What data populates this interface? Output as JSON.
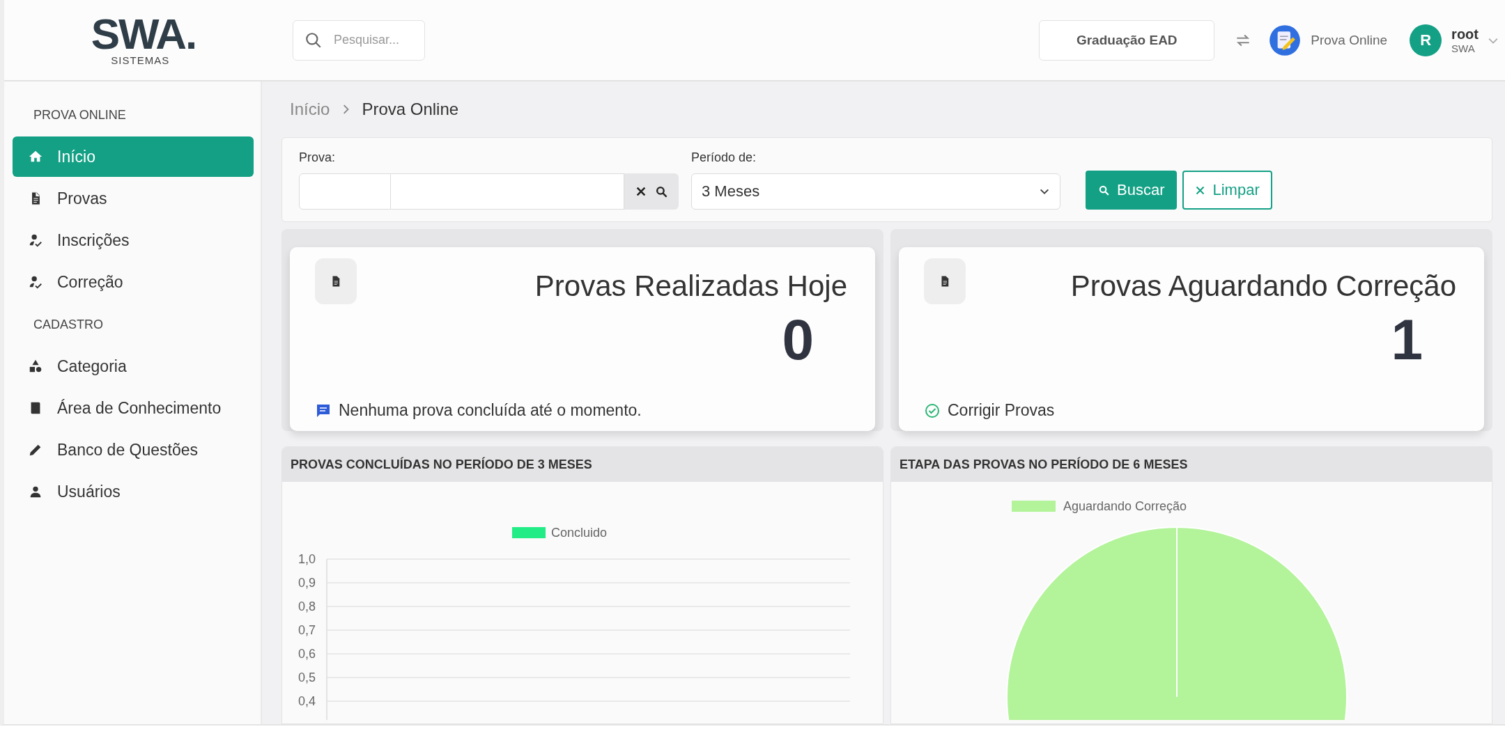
{
  "header": {
    "logo": {
      "wordmark": "SWA.",
      "subtitle": "SISTEMAS"
    },
    "search": {
      "placeholder": "Pesquisar..."
    },
    "context_button": "Graduação EAD",
    "module": {
      "label": "Prova Online"
    },
    "user": {
      "initial": "R",
      "name": "root",
      "org": "SWA"
    }
  },
  "sidebar": {
    "sections": [
      {
        "title": "PROVA ONLINE",
        "items": [
          {
            "label": "Início",
            "selected": true
          },
          {
            "label": "Provas",
            "selected": false
          },
          {
            "label": "Inscrições",
            "selected": false
          },
          {
            "label": "Correção",
            "selected": false
          }
        ]
      },
      {
        "title": "CADASTRO",
        "items": [
          {
            "label": "Categoria",
            "selected": false
          },
          {
            "label": "Área de Conhecimento",
            "selected": false
          },
          {
            "label": "Banco de Questões",
            "selected": false
          },
          {
            "label": "Usuários",
            "selected": false
          }
        ]
      }
    ]
  },
  "breadcrumb": [
    "Início",
    "Prova Online"
  ],
  "filters": {
    "prova": {
      "label": "Prova:"
    },
    "periodo": {
      "label": "Período de:",
      "value": "3 Meses"
    },
    "buttons": [
      {
        "label": "Buscar",
        "kind": "primary"
      },
      {
        "label": "Limpar",
        "kind": "outline"
      }
    ]
  },
  "cards": [
    {
      "title": "Provas Realizadas Hoje",
      "value": "0",
      "footer": "Nenhuma prova concluída até o momento."
    },
    {
      "title": "Provas Aguardando Correção",
      "value": "1",
      "footer": "Corrigir Provas"
    }
  ],
  "charts": [
    {
      "title": "PROVAS CONCLUÍDAS NO PERÍODO DE 3 MESES",
      "chart_data": {
        "type": "bar",
        "grid": true,
        "ylim": [
          0,
          1
        ],
        "yticks": [
          {
            "value": 1.0,
            "label": "1,0"
          },
          {
            "value": 0.9,
            "label": "0,9"
          },
          {
            "value": 0.8,
            "label": "0,8"
          },
          {
            "value": 0.7,
            "label": "0,7"
          },
          {
            "value": 0.6,
            "label": "0,6"
          },
          {
            "value": 0.5,
            "label": "0,5"
          },
          {
            "value": 0.4,
            "label": "0,4"
          }
        ],
        "series": [
          {
            "name": "Concluido",
            "color": "#22ec86"
          }
        ]
      }
    },
    {
      "title": "ETAPA DAS PROVAS NO PERÍODO DE 6 MESES",
      "chart_data": {
        "type": "pie",
        "series": [
          {
            "name": "Aguardando Correção",
            "color": "#b3f39a",
            "values": [
              100
            ]
          }
        ]
      }
    }
  ]
}
